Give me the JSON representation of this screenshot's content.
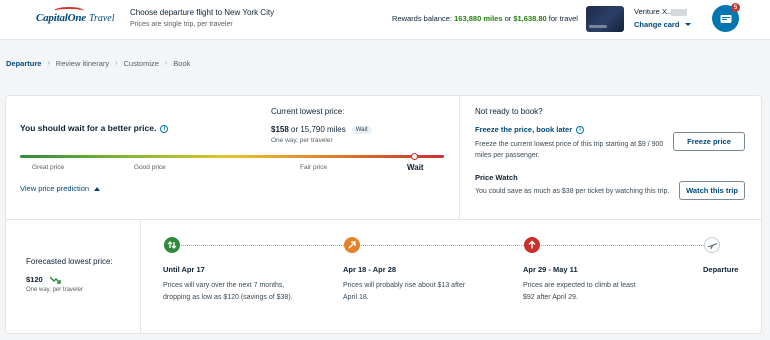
{
  "header": {
    "brand": "Capital",
    "brand_suffix": "One",
    "product": "Travel",
    "flight_title": "Choose departure flight to New York City",
    "flight_sub": "Prices are single trip, per traveler",
    "rewards_prefix": "Rewards balance: ",
    "rewards_miles": "163,880 miles",
    "rewards_or": " or ",
    "rewards_cash": "$1,638.80",
    "rewards_suffix": " for travel",
    "card_name": "Venture X..",
    "change_card": "Change card",
    "cart_count": "5"
  },
  "breadcrumb": [
    "Departure",
    "Review itinerary",
    "Customize",
    "Book"
  ],
  "prediction": {
    "title": "You should wait for a better price.",
    "current_label": "Current lowest price:",
    "current_price": "$158",
    "current_miles": " or 15,790 miles",
    "badge": "Wait",
    "current_sub": "One way, per traveler",
    "gauge_labels": [
      "Great price",
      "Good price",
      "Fair price"
    ],
    "gauge_verdict": "Wait",
    "view_link": "View price prediction"
  },
  "sidebar": {
    "not_ready": "Not ready to book?",
    "freeze_title": "Freeze the price, book later",
    "freeze_desc": "Freeze the current lowest price of this trip starting at $9 / 900 miles per passenger.",
    "freeze_button": "Freeze price",
    "watch_title": "Price Watch",
    "watch_desc": "You could save as much as $38 per ticket by watching this trip.",
    "watch_button": "Watch this trip"
  },
  "forecast": {
    "label": "Forecasted lowest price:",
    "price": "$120",
    "sub": "One way, per traveler",
    "steps": [
      {
        "title": "Until Apr 17",
        "desc_a": "Prices will vary over the next 7 months, dropping as low as ",
        "desc_b": "$120",
        "desc_c": " (savings of $38).",
        "color": "#2e8b3a",
        "icon": "up-down-arrows-icon"
      },
      {
        "title": "Apr 18 - Apr 28",
        "desc_a": "Prices will probably rise about ",
        "desc_b": "$13",
        "desc_c": " after April 18.",
        "color": "#e3822a",
        "icon": "arrow-up-right-icon"
      },
      {
        "title": "Apr 29 - May 11",
        "desc_a": "Prices are expected to climb at least ",
        "desc_b": "$92",
        "desc_c": " after April 29.",
        "color": "#c9302c",
        "icon": "arrow-up-icon"
      },
      {
        "title": "Departure",
        "icon": "airplane-icon"
      }
    ]
  },
  "colors": {
    "brand_blue": "#004878",
    "accent_blue": "#0276b1",
    "green": "#25810e",
    "red": "#d03027"
  }
}
